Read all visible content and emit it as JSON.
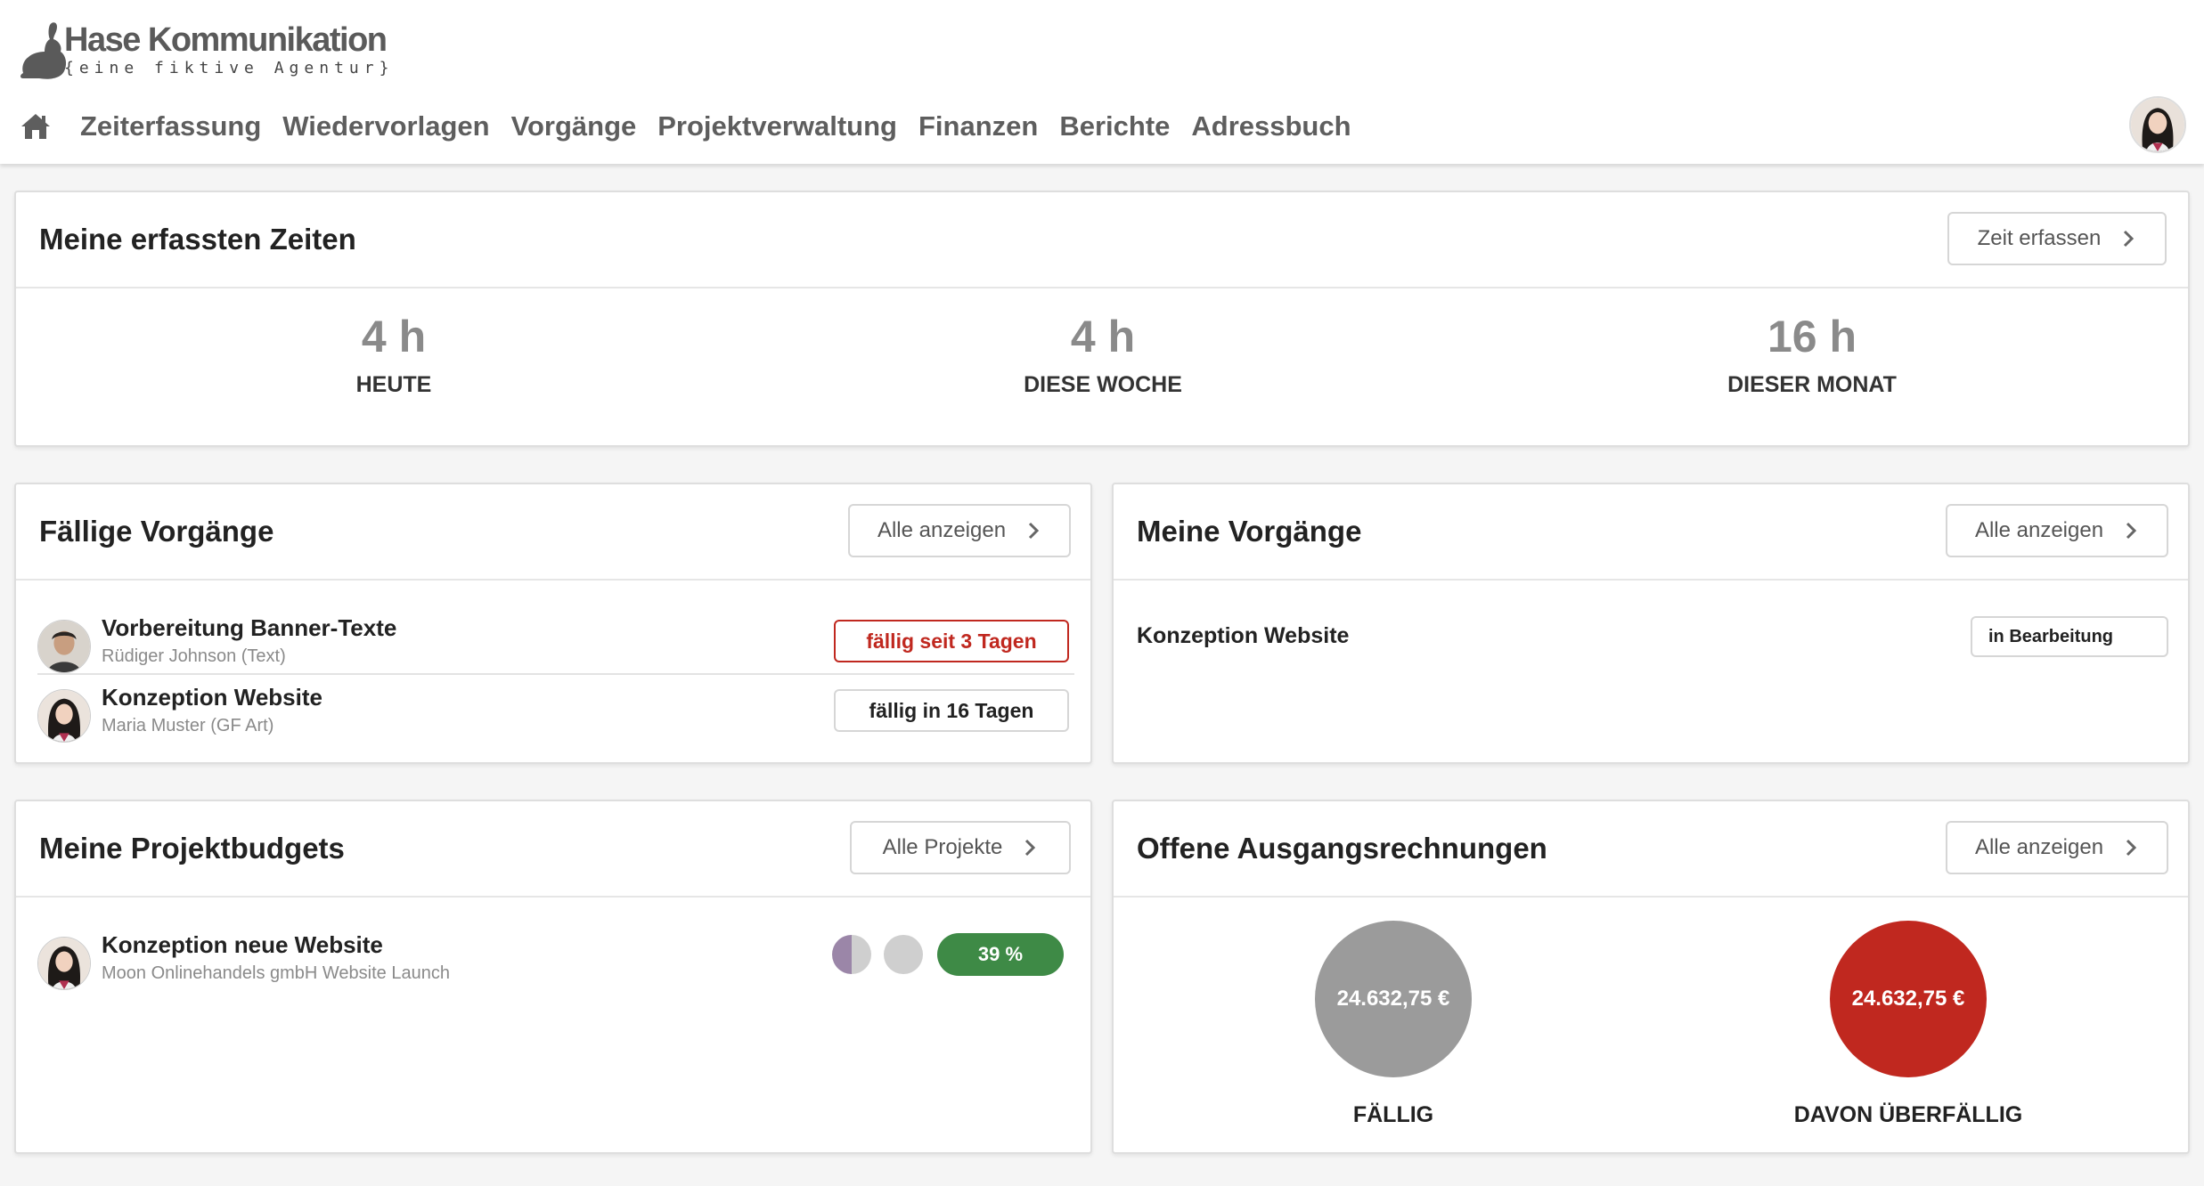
{
  "brand": {
    "name": "Hase Kommunikation",
    "tagline": "{eine fiktive Agentur}"
  },
  "nav": {
    "items": [
      "Zeiterfassung",
      "Wiedervorlagen",
      "Vorgänge",
      "Projektverwaltung",
      "Finanzen",
      "Berichte",
      "Adressbuch"
    ]
  },
  "times": {
    "title": "Meine erfassten Zeiten",
    "button": "Zeit erfassen",
    "stats": [
      {
        "value": "4 h",
        "label": "HEUTE"
      },
      {
        "value": "4 h",
        "label": "DIESE WOCHE"
      },
      {
        "value": "16 h",
        "label": "DIESER MONAT"
      }
    ]
  },
  "due": {
    "title": "Fällige Vorgänge",
    "button": "Alle anzeigen",
    "items": [
      {
        "title": "Vorbereitung Banner-Texte",
        "sub": "Rüdiger Johnson (Text)",
        "status": "fällig seit 3 Tagen"
      },
      {
        "title": "Konzeption Website",
        "sub": "Maria Muster (GF Art)",
        "status": "fällig in 16 Tagen"
      }
    ]
  },
  "mine": {
    "title": "Meine Vorgänge",
    "button": "Alle anzeigen",
    "items": [
      {
        "title": "Konzeption Website",
        "status": "in Bearbeitung"
      }
    ]
  },
  "budgets": {
    "title": "Meine Projektbudgets",
    "button": "Alle Projekte",
    "items": [
      {
        "title": "Konzeption neue Website",
        "sub": "Moon Onlinehandels gmbH Website Launch",
        "percent": "39 %"
      }
    ]
  },
  "invoices": {
    "title": "Offene Ausgangsrechnungen",
    "button": "Alle anzeigen",
    "due_amount": "24.632,75 €",
    "due_label": "FÄLLIG",
    "overdue_amount": "24.632,75 €",
    "overdue_label": "DAVON ÜBERFÄLLIG"
  },
  "colors": {
    "overdue_red": "#c0281f",
    "due_gray": "#9b9b9b",
    "budget_green": "#3e8a46",
    "nav_text": "#5e5e5e"
  },
  "icons": [
    "rabbit-logo-icon",
    "home-icon",
    "chevron-right-icon",
    "user-avatar"
  ]
}
